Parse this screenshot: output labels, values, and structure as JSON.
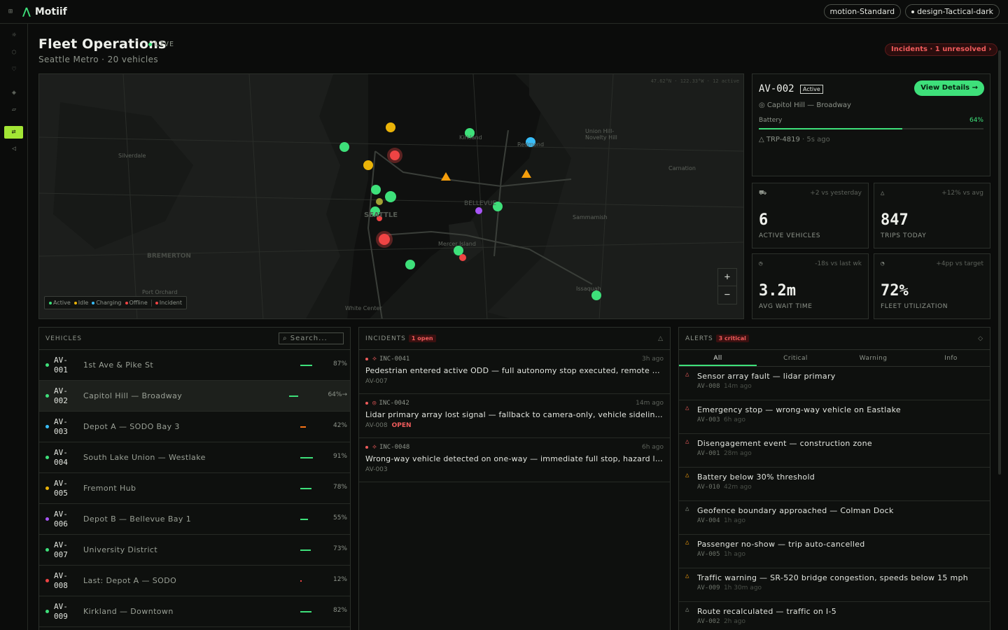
{
  "app": {
    "name": "Motiif"
  },
  "topbar": {
    "chips": [
      "motion-Standard",
      "design-Tactical-dark"
    ]
  },
  "page": {
    "title": "Fleet Operations",
    "live": "LIVE",
    "subtitle": "Seattle Metro · 20 vehicles",
    "incidents_badge": "Incidents · 1 unresolved  ›"
  },
  "map": {
    "corner": "47.62°N · 122.33°W · 12 active",
    "labels": {
      "silverdale": "Silverdale",
      "bremerton": "BREMERTON",
      "port_orchard": "Port Orchard",
      "white_center": "White Center",
      "seattle": "SEATTLE",
      "bellevue": "BELLEVUE",
      "mercer": "Mercer Island",
      "kirkland": "Kirkland",
      "redmond": "Redmond",
      "union_hill": "Union Hill-\nNovelty Hill",
      "carnation": "Carnation",
      "sammamish": "Sammamish",
      "issaquah": "Issaquah"
    },
    "legend": {
      "active": "Active",
      "idle": "Idle",
      "charging": "Charging",
      "offline": "Offline",
      "incident": "Incident"
    },
    "zoom_in": "+",
    "zoom_out": "−"
  },
  "selected": {
    "id": "AV-002",
    "status": "Active",
    "action": "View Details →",
    "location": "Capitol Hill — Broadway",
    "battery_label": "Battery",
    "battery": "64%",
    "battery_fraction": 0.64,
    "trip": "TRP-4819",
    "trip_ago": "· 5s ago"
  },
  "kpis": [
    {
      "delta": "+2 vs yesterday",
      "value": "6",
      "label": "ACTIVE VEHICLES"
    },
    {
      "delta": "+12% vs avg",
      "value": "847",
      "label": "TRIPS TODAY"
    },
    {
      "delta": "-18s vs last wk",
      "value": "3.2m",
      "label": "AVG WAIT TIME"
    },
    {
      "delta": "+4pp vs target",
      "value": "72%",
      "label": "FLEET UTILIZATION"
    }
  ],
  "vehicles_panel": {
    "title": "VEHICLES",
    "search_placeholder": "⌕ Search..."
  },
  "vehicles": [
    {
      "id1": "AV-",
      "id2": "001",
      "loc": "1st Ave & Pike St",
      "pct": "87%",
      "level": 0.87,
      "color": "#3ee07a",
      "bar": "#3ee07a"
    },
    {
      "id1": "AV-",
      "id2": "002",
      "loc": "Capitol Hill — Broadway",
      "pct": "64%→",
      "level": 0.64,
      "color": "#3ee07a",
      "bar": "#3ee07a"
    },
    {
      "id1": "AV-",
      "id2": "003",
      "loc": "Depot A — SODO Bay 3",
      "pct": "42%",
      "level": 0.42,
      "color": "#38bdf8",
      "bar": "#f97316"
    },
    {
      "id1": "AV-",
      "id2": "004",
      "loc": "South Lake Union — Westlake",
      "pct": "91%",
      "level": 0.91,
      "color": "#3ee07a",
      "bar": "#3ee07a"
    },
    {
      "id1": "AV-",
      "id2": "005",
      "loc": "Fremont Hub",
      "pct": "78%",
      "level": 0.78,
      "color": "#eab308",
      "bar": "#3ee07a"
    },
    {
      "id1": "AV-",
      "id2": "006",
      "loc": "Depot B — Bellevue Bay 1",
      "pct": "55%",
      "level": 0.55,
      "color": "#a855f7",
      "bar": "#3ee07a"
    },
    {
      "id1": "AV-",
      "id2": "007",
      "loc": "University District",
      "pct": "73%",
      "level": 0.73,
      "color": "#3ee07a",
      "bar": "#3ee07a"
    },
    {
      "id1": "AV-",
      "id2": "008",
      "loc": "Last: Depot A — SODO",
      "pct": "12%",
      "level": 0.12,
      "color": "#ef4444",
      "bar": "#ef4444"
    },
    {
      "id1": "AV-",
      "id2": "009",
      "loc": "Kirkland — Downtown",
      "pct": "82%",
      "level": 0.82,
      "color": "#3ee07a",
      "bar": "#3ee07a"
    }
  ],
  "incidents_panel": {
    "title": "INCIDENTS",
    "count": "1 open"
  },
  "incidents": [
    {
      "sym": "⟡",
      "id": "INC-0041",
      "ago": "3h ago",
      "text": "Pedestrian entered active ODD — full autonomy stop executed, remote operator notified",
      "vehicle": "AV-007",
      "open": ""
    },
    {
      "sym": "◎",
      "id": "INC-0042",
      "ago": "14m ago",
      "text": "Lidar primary array lost signal — fallback to camera-only, vehicle sidelined",
      "vehicle": "AV-008",
      "open": "OPEN"
    },
    {
      "sym": "⟡",
      "id": "INC-0048",
      "ago": "6h ago",
      "text": "Wrong-way vehicle detected on one-way — immediate full stop, hazard lights activated",
      "vehicle": "AV-003",
      "open": ""
    }
  ],
  "alerts_panel": {
    "title": "ALERTS",
    "count": "3 critical",
    "tabs": [
      "All",
      "Critical",
      "Warning",
      "Info"
    ]
  },
  "alerts": [
    {
      "sev": "critical",
      "text": "Sensor array fault — lidar primary",
      "vehicle": "AV-008",
      "ago": "14m ago"
    },
    {
      "sev": "critical",
      "text": "Emergency stop — wrong-way vehicle on Eastlake",
      "vehicle": "AV-003",
      "ago": "6h ago"
    },
    {
      "sev": "critical",
      "text": "Disengagement event — construction zone",
      "vehicle": "AV-001",
      "ago": "28m ago"
    },
    {
      "sev": "warning",
      "text": "Battery below 30% threshold",
      "vehicle": "AV-010",
      "ago": "42m ago"
    },
    {
      "sev": "info",
      "text": "Geofence boundary approached — Colman Dock",
      "vehicle": "AV-004",
      "ago": "1h ago"
    },
    {
      "sev": "warning",
      "text": "Passenger no-show — trip auto-cancelled",
      "vehicle": "AV-005",
      "ago": "1h ago"
    },
    {
      "sev": "warning",
      "text": "Traffic warning — SR-520 bridge congestion, speeds below 15 mph",
      "vehicle": "AV-009",
      "ago": "1h 30m ago"
    },
    {
      "sev": "info",
      "text": "Route recalculated — traffic on I-5",
      "vehicle": "AV-002",
      "ago": "2h ago"
    }
  ]
}
